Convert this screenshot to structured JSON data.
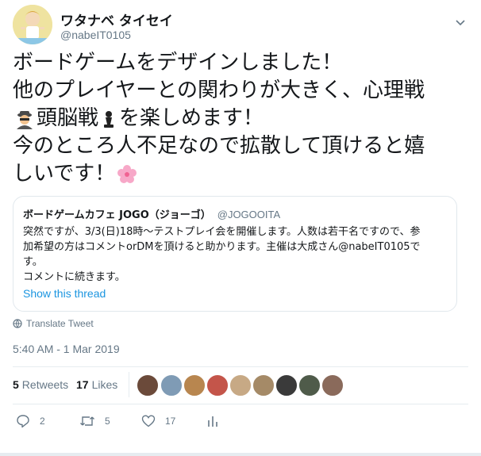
{
  "author": {
    "display_name": "ワタナベ タイセイ",
    "handle": "@nabeIT0105"
  },
  "tweet": {
    "lines": [
      "ボードゲームをデザインしました！",
      "他のプレイヤーとの関わりが大きく、心理戦",
      "頭脳戦",
      "を楽しめます！",
      "今のところ人不足なので拡散して頂けると嬉",
      "しいです！"
    ],
    "emoji_spy": "detective-emoji",
    "emoji_chess": "chess-pawn-emoji",
    "emoji_flower": "cherry-blossom-emoji"
  },
  "quoted_tweet": {
    "name": "ボードゲームカフェ JOGO（ジョーゴ）",
    "handle": "@JOGOOITA",
    "body_lines": [
      "突然ですが、3/3(日)18時〜テストプレイ会を開催します。人数は若干名ですので、参",
      "加希望の方はコメントorDMを頂けると助かります。主催は大成さん@nabeIT0105で",
      "す。",
      "コメントに続きます。"
    ],
    "show_thread": "Show this thread"
  },
  "translate_label": "Translate Tweet",
  "timestamp": "5:40 AM - 1 Mar 2019",
  "stats": {
    "retweets_count": "5",
    "retweets_label": "Retweets",
    "likes_count": "17",
    "likes_label": "Likes"
  },
  "actions": {
    "reply_count": "2",
    "retweet_count": "5",
    "like_count": "17"
  },
  "colors": {
    "link_blue": "#1b95e0",
    "muted_gray": "#657786",
    "border": "#e1e8ed"
  }
}
